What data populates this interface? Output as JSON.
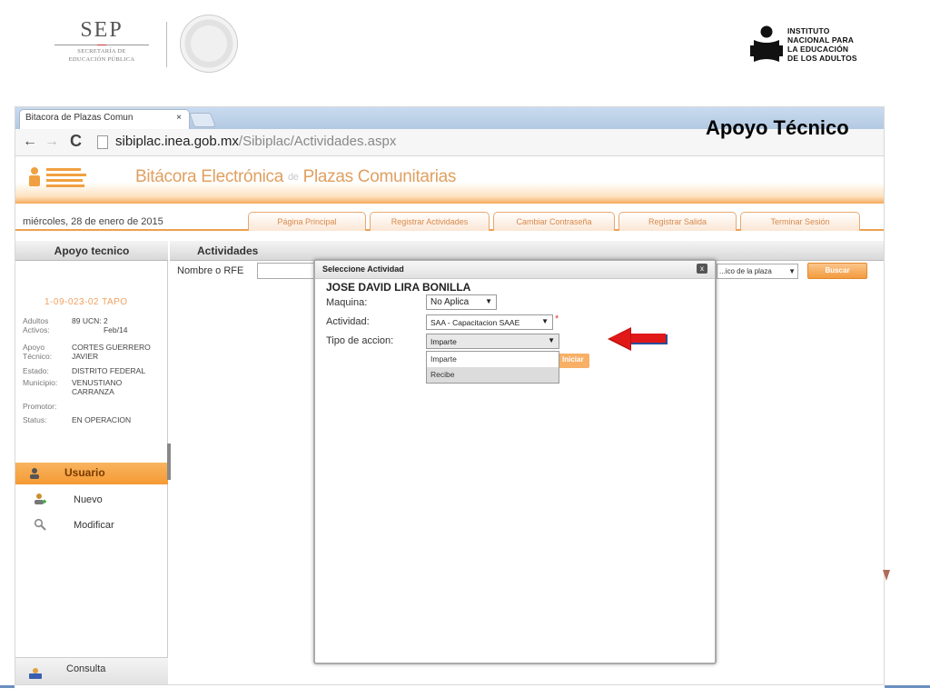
{
  "header": {
    "sep_logo": {
      "name": "SEP",
      "sub1": "SECRETARÍA DE",
      "sub2": "EDUCACIÓN PÚBLICA"
    },
    "inea_logo": {
      "line1": "INSTITUTO",
      "line2": "NACIONAL PARA",
      "line3": "LA EDUCACIÓN",
      "line4": "DE LOS ADULTOS"
    },
    "slide_title": "Apoyo Técnico"
  },
  "browser": {
    "tab_title": "Bitacora de Plazas Comun",
    "tab_close": "×",
    "url_domain": "sibiplac.inea.gob.mx",
    "url_path": "/Sibiplac/Actividades.aspx"
  },
  "app": {
    "title_main": "Bitácora Electrónica",
    "title_sep": "de",
    "title_sub": "Plazas Comunitarias",
    "date": "miércoles, 28 de enero de 2015",
    "nav_tabs": [
      {
        "label": "Página Principal"
      },
      {
        "label": "Registrar Actividades"
      },
      {
        "label": "Cambiar Contraseña"
      },
      {
        "label": "Registrar Salida"
      },
      {
        "label": "Terminar Sesión"
      }
    ]
  },
  "sidebar": {
    "heading": "Apoyo tecnico",
    "plaza_code": "1-09-023-02 TAPO",
    "rows": [
      {
        "key": "Adultos Activos:",
        "value": "89  UCN:"
      },
      {
        "key": "Apoyo Técnico:",
        "value": "CORTES GUERRERO JAVIER"
      },
      {
        "key": "Estado:",
        "value": "DISTRITO FEDERAL"
      },
      {
        "key": "Municipio:",
        "value": "VENUSTIANO CARRANZA"
      },
      {
        "key": "Promotor:",
        "value": ""
      },
      {
        "key": "Status:",
        "value": "EN OPERACION"
      }
    ],
    "ucn_value": "2 Feb/14",
    "usuario_label": "Usuario",
    "items": [
      {
        "label": "Nuevo"
      },
      {
        "label": "Modificar"
      }
    ],
    "consulta_label": "Consulta"
  },
  "main": {
    "heading": "Actividades",
    "rfe_label": "Nombre o RFE",
    "plaza_select": "...ico de la plaza",
    "search_button": "Buscar"
  },
  "modal": {
    "title": "Seleccione Actividad",
    "close": "x",
    "person_name": "JOSE DAVID LIRA BONILLA",
    "maquina_label": "Maquina:",
    "maquina_value": "No Aplica",
    "actividad_label": "Actividad:",
    "actividad_value": "SAA - Capacitacion SAAE",
    "required_mark": "*",
    "tipo_label": "Tipo de accion:",
    "tipo_value": "Imparte",
    "tipo_options": [
      "Imparte",
      "Recibe"
    ],
    "ghost_button": "Iniciar",
    "arrow_glyph": "▼"
  },
  "colors": {
    "accent_orange": "#f59a34",
    "arrow_red": "#e01818",
    "arrow_blue": "#2a4f9a"
  }
}
